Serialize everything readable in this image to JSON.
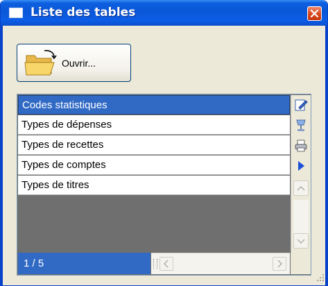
{
  "window": {
    "title": "Liste des tables"
  },
  "toolbar": {
    "open_label": "Ouvrir..."
  },
  "table": {
    "rows": [
      "Codes statistiques",
      "Types de dépenses",
      "Types de recettes",
      "Types de comptes",
      "Types de titres"
    ],
    "selected_row": 0,
    "counter": "1 / 5"
  },
  "colors": {
    "accent": "#316ac5",
    "titlebar": "#0a57d8",
    "empty_area": "#6f6f6f"
  },
  "icons": [
    "window-icon",
    "close-icon",
    "folder-icon",
    "edit-icon",
    "goblet-icon",
    "printer-icon",
    "play-arrow-icon",
    "scroll-up-icon",
    "scroll-down-icon",
    "scroll-left-icon",
    "scroll-right-icon"
  ]
}
